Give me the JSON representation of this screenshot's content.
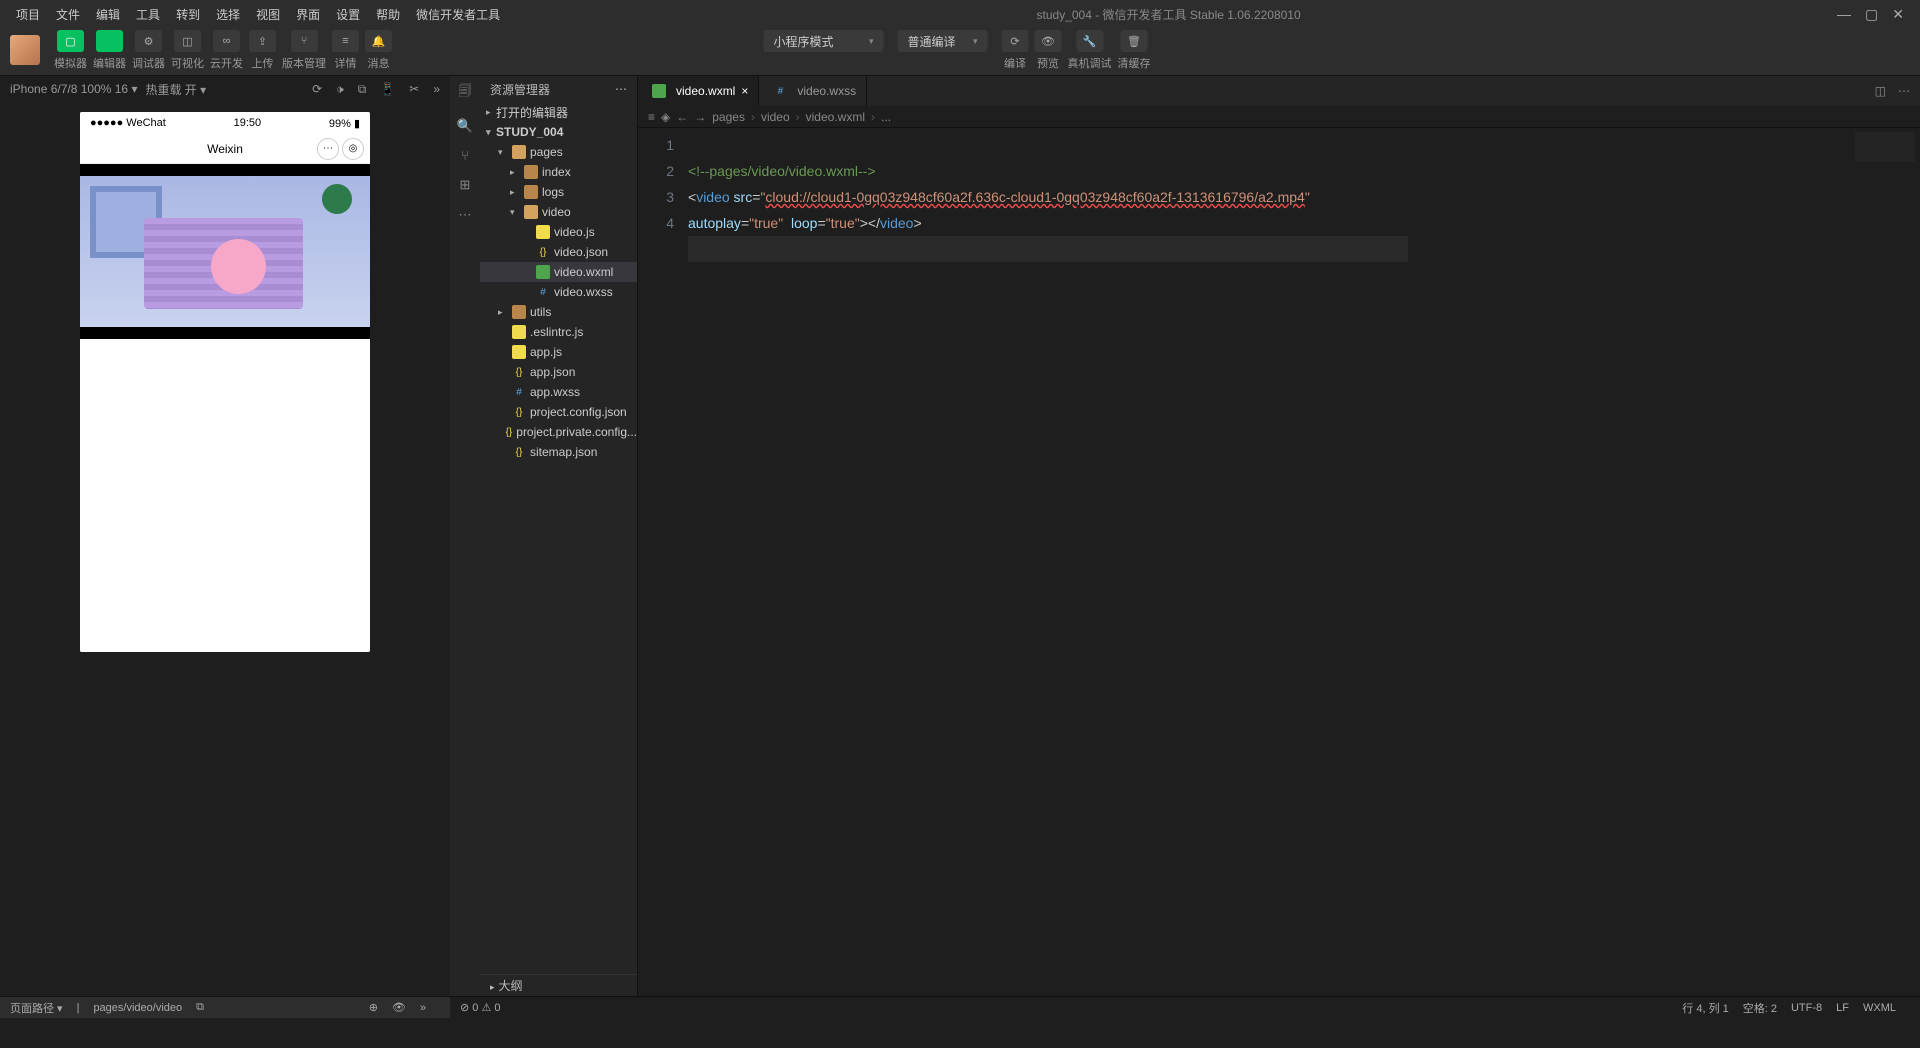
{
  "menu": [
    "项目",
    "文件",
    "编辑",
    "工具",
    "转到",
    "选择",
    "视图",
    "界面",
    "设置",
    "帮助",
    "微信开发者工具"
  ],
  "title": "study_004 - 微信开发者工具 Stable 1.06.2208010",
  "toolbar": {
    "groups": [
      {
        "labels": [
          "模拟器",
          "编辑器",
          "调试器",
          "可视化",
          "云开发"
        ],
        "green": 2
      },
      {
        "labels": [
          "上传",
          "版本管理",
          "详情",
          "消息"
        ]
      }
    ],
    "center": {
      "mode": "小程序模式",
      "compile": "普通编译",
      "btn_labels": [
        "编译",
        "预览",
        "真机调试",
        "清缓存"
      ]
    }
  },
  "sim": {
    "device": "iPhone 6/7/8 100% 16",
    "reload": "热重载 开",
    "status_left": "●●●●● WeChat",
    "time": "19:50",
    "battery": "99%",
    "nav_title": "Weixin"
  },
  "explorer": {
    "title": "资源管理器",
    "section1": "打开的编辑器",
    "project": "STUDY_004",
    "outline": "大纲",
    "tree": [
      {
        "d": 1,
        "chev": "▾",
        "ico": "fld-o",
        "label": "pages"
      },
      {
        "d": 2,
        "chev": "▸",
        "ico": "fld",
        "label": "index"
      },
      {
        "d": 2,
        "chev": "▸",
        "ico": "fld",
        "label": "logs"
      },
      {
        "d": 2,
        "chev": "▾",
        "ico": "fld-o",
        "label": "video"
      },
      {
        "d": 3,
        "chev": "",
        "ico": "js",
        "label": "video.js"
      },
      {
        "d": 3,
        "chev": "",
        "ico": "json",
        "label": "video.json"
      },
      {
        "d": 3,
        "chev": "",
        "ico": "wxml",
        "label": "video.wxml",
        "active": true
      },
      {
        "d": 3,
        "chev": "",
        "ico": "wxss",
        "label": "video.wxss"
      },
      {
        "d": 1,
        "chev": "▸",
        "ico": "fld",
        "label": "utils"
      },
      {
        "d": 1,
        "chev": "",
        "ico": "js",
        "label": ".eslintrc.js"
      },
      {
        "d": 1,
        "chev": "",
        "ico": "js",
        "label": "app.js"
      },
      {
        "d": 1,
        "chev": "",
        "ico": "json",
        "label": "app.json"
      },
      {
        "d": 1,
        "chev": "",
        "ico": "wxss",
        "label": "app.wxss"
      },
      {
        "d": 1,
        "chev": "",
        "ico": "json",
        "label": "project.config.json"
      },
      {
        "d": 1,
        "chev": "",
        "ico": "json",
        "label": "project.private.config..."
      },
      {
        "d": 1,
        "chev": "",
        "ico": "json",
        "label": "sitemap.json"
      }
    ]
  },
  "tabs": [
    {
      "ico": "wxml",
      "label": "video.wxml",
      "active": true,
      "close": true
    },
    {
      "ico": "wxss",
      "label": "video.wxss",
      "active": false,
      "close": false
    }
  ],
  "crumbs": [
    "pages",
    "video",
    "video.wxml",
    "..."
  ],
  "crumb_icons": [
    "",
    "📘",
    ""
  ],
  "code": {
    "lines": [
      "1",
      "2",
      "3",
      "4"
    ],
    "l1": "<!--pages/video/video.wxml-->",
    "l2_tag": "video",
    "l2_attr": "src",
    "l2_url": "cloud://cloud1-0gq03z948cf60a2f.636c-cloud1-0gq03z948cf60a2f-1313616796/a2.mp4",
    "l3_a1": "autoplay",
    "l3_v1": "\"true\"",
    "l3_a2": "loop",
    "l3_v2": "\"true\"",
    "l3_close": "</",
    "l3_tag": "video"
  },
  "footer": {
    "left_path": "页面路径 ▾",
    "left_route": "pages/video/video",
    "stat1": "⊘ 0 ⚠ 0",
    "pos": "行 4, 列 1",
    "spaces": "空格: 2",
    "enc": "UTF-8",
    "eol": "LF",
    "lang": "WXML"
  }
}
